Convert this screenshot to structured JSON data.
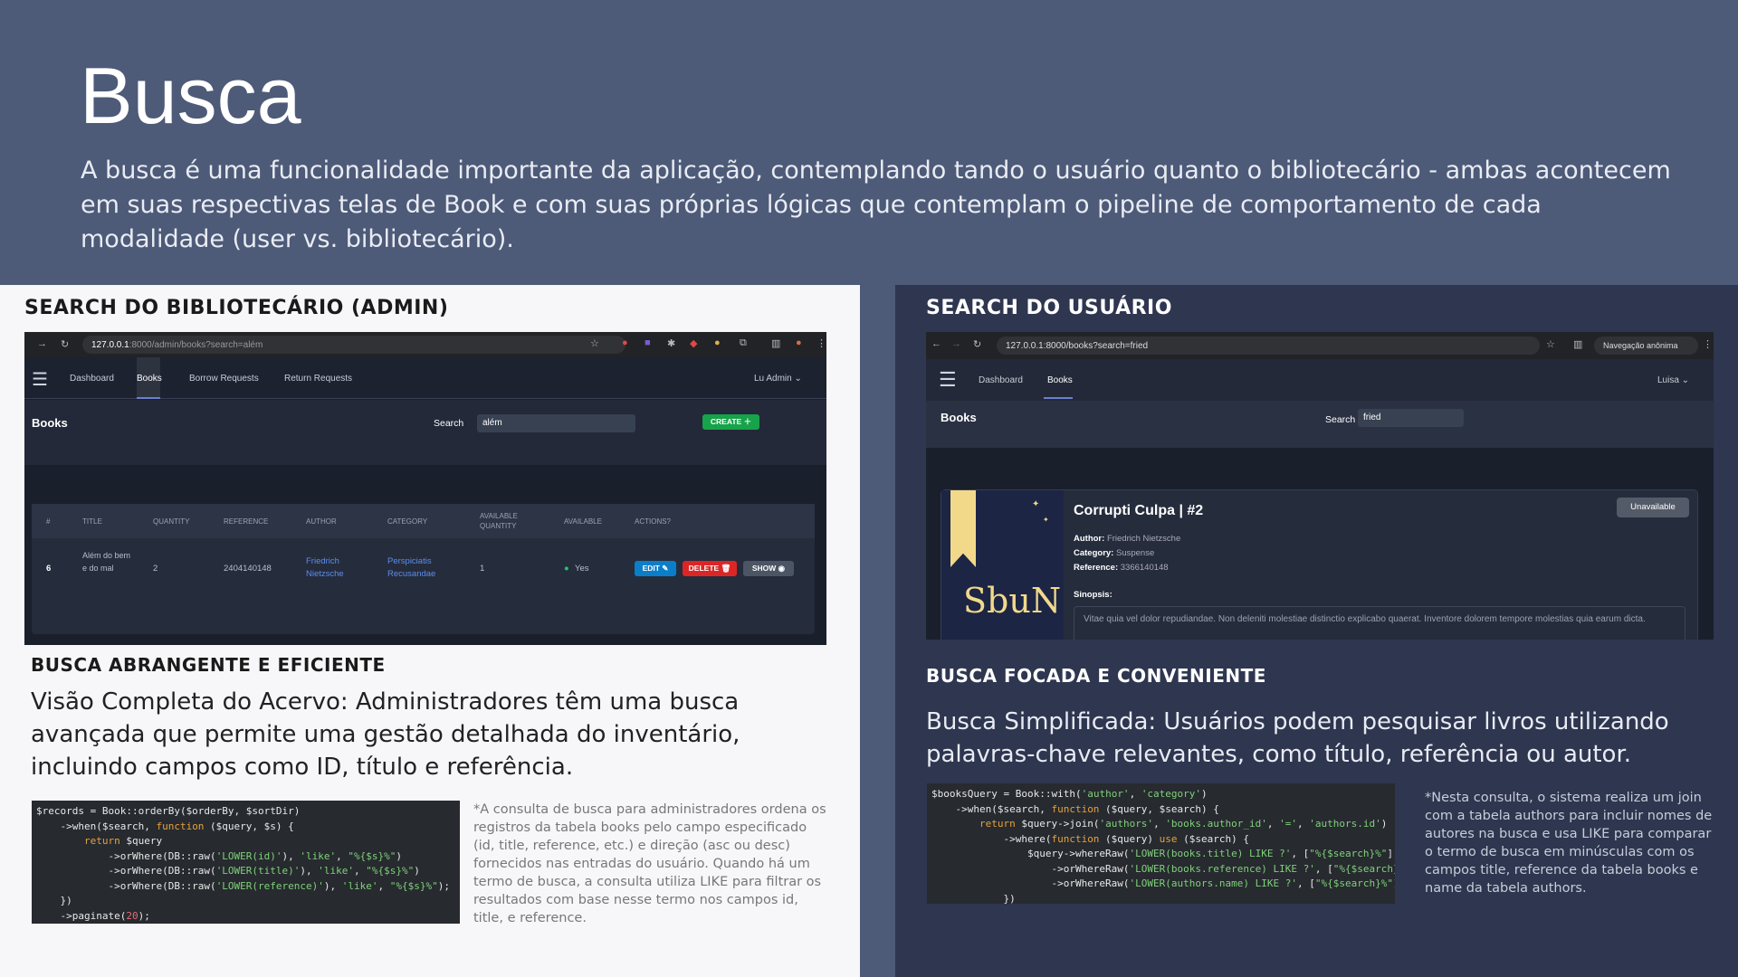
{
  "header": {
    "title": "Busca",
    "intro": "A busca é uma funcionalidade importante da aplicação, contemplando tando o usuário quanto o bibliotecário - ambas acontecem em suas respectivas telas de Book e com suas próprias lógicas que contemplam o pipeline de comportamento de cada modalidade (user vs. bibliotecário)."
  },
  "left": {
    "section_title": "SEARCH DO BIBLIOTECÁRIO (ADMIN)",
    "subtitle": "BUSCA ABRANGENTE E EFICIENTE",
    "body": "Visão Completa do Acervo: Administradores têm uma busca avançada que permite uma gestão detalhada do inventário, incluindo campos como ID, título e referência.",
    "note": "*A consulta de busca para administradores ordena os registros da tabela books pelo campo especificado (id, title, reference, etc.) e direção (asc ou desc) fornecidos nas entradas do usuário. Quando há um termo de busca, a consulta utiliza LIKE para filtrar os resultados com base nesse termo nos campos id, title, e reference.",
    "screenshot": {
      "url_host": "127.0.0.1",
      "url_rest": ":8000/admin/books?search=além",
      "nav": [
        "Dashboard",
        "Books",
        "Borrow Requests",
        "Return Requests"
      ],
      "user": "Lu Admin ⌄",
      "page_title": "Books",
      "search_label": "Search",
      "search_value": "além",
      "create_label": "CREATE ＋",
      "columns": [
        "#",
        "TITLE",
        "QUANTITY",
        "REFERENCE",
        "AUTHOR",
        "CATEGORY",
        "AVAILABLE QUANTITY",
        "AVAILABLE",
        "ACTIONS?"
      ],
      "row": {
        "id": "6",
        "title": "Além do bem e do mal",
        "quantity": "2",
        "reference": "2404140148",
        "author": "Friedrich Nietzsche",
        "category": "Perspiciatis Recusandae",
        "available_quantity": "1",
        "available": "Yes"
      },
      "edit": "EDIT ✎",
      "delete": "DELETE 🗑",
      "show": "SHOW ◉"
    }
  },
  "right": {
    "section_title": "SEARCH DO USUÁRIO",
    "subtitle": "BUSCA FOCADA E CONVENIENTE",
    "body": "Busca Simplificada: Usuários podem pesquisar livros utilizando palavras-chave relevantes, como título, referência ou autor.",
    "note": "*Nesta consulta, o sistema realiza um join com a tabela authors para incluir nomes de autores na busca e usa LIKE para comparar o termo de busca em minúsculas com os campos title, reference da tabela books e name da tabela authors.",
    "screenshot": {
      "url": "127.0.0.1:8000/books?search=fried",
      "incognito": "Navegação anônima",
      "nav": [
        "Dashboard",
        "Books"
      ],
      "user": "Luisa ⌄",
      "page_title": "Books",
      "search_label": "Search",
      "search_value": "fried",
      "book_title": "Corrupti Culpa | #2",
      "badge": "Unavailable",
      "author_label": "Author:",
      "author": "Friedrich Nietzsche",
      "category_label": "Category:",
      "category": "Suspense",
      "reference_label": "Reference:",
      "reference": "3366140148",
      "synopsis_label": "Sinopsis:",
      "synopsis": "Vitae quia vel dolor repudiandae. Non deleniti molestiae distinctio explicabo quaerat. Inventore dolorem tempore molestias quia earum dicta.",
      "cover_text": "SbuN"
    }
  }
}
